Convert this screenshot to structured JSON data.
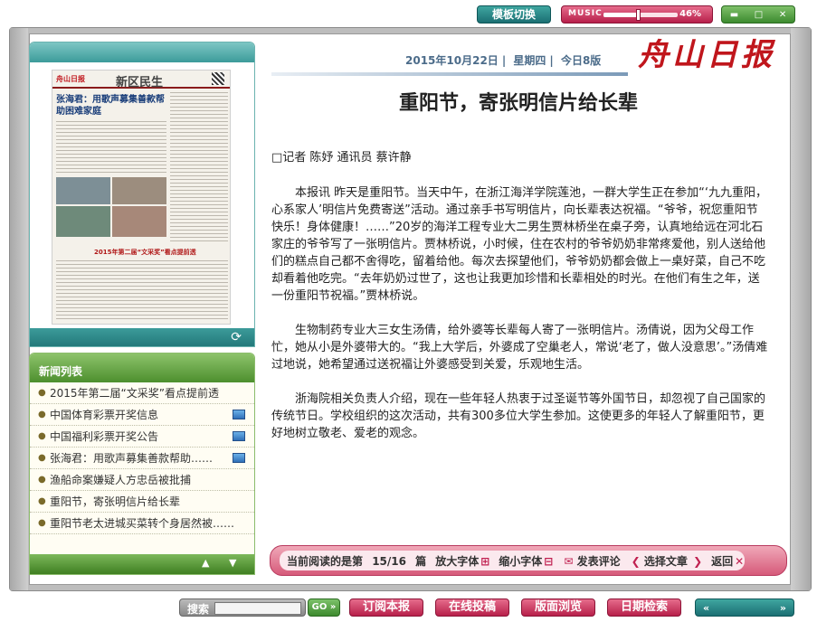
{
  "topbar": {
    "template_switch": "模板切换",
    "music_label": "MUSIC",
    "music_volume_pct": 46,
    "music_volume_text": "46%",
    "min_icon": "minimize-icon",
    "restore_icon": "restore-icon",
    "close_icon": "close-icon"
  },
  "thumbnail": {
    "paper_logo": "舟山日报",
    "section": "新区民生",
    "headline": "张海君：用歌声募集善款帮助困难家庭",
    "banner": "2015年第二届“文采奖”看点提前透",
    "refresh_icon": "refresh-icon"
  },
  "news_list": {
    "title": "新闻列表",
    "items": [
      {
        "label": "2015年第二届“文采奖”看点提前透",
        "has_pic": false
      },
      {
        "label": "中国体育彩票开奖信息",
        "has_pic": true
      },
      {
        "label": "中国福利彩票开奖公告",
        "has_pic": true
      },
      {
        "label": "张海君：用歌声募集善款帮助……",
        "has_pic": true
      },
      {
        "label": "渔船命案嫌疑人方忠岳被批捕",
        "has_pic": false
      },
      {
        "label": "重阳节，寄张明信片给长辈",
        "has_pic": false
      },
      {
        "label": "重阳节老太进城买菜转个身居然被……",
        "has_pic": false
      }
    ],
    "up_icon": "arrow-up-icon",
    "down_icon": "arrow-down-icon"
  },
  "header": {
    "date": "2015年10月22日",
    "weekday": "星期四",
    "editions": "今日8版",
    "masthead": "舟山日报"
  },
  "article": {
    "title": "重阳节，寄张明信片给长辈",
    "byline": "□记者 陈妤 通讯员 蔡许静",
    "paragraphs": [
      "本报讯 昨天是重阳节。当天中午，在浙江海洋学院莲池，一群大学生正在参加“‘九九重阳，心系家人’明信片免费寄送”活动。通过亲手书写明信片，向长辈表达祝福。“爷爷，祝您重阳节快乐！身体健康！……”20岁的海洋工程专业大二男生贾林桥坐在桌子旁，认真地给远在河北石家庄的爷爷写了一张明信片。贾林桥说，小时候，住在农村的爷爷奶奶非常疼爱他，别人送给他们的糕点自己都不舍得吃，留着给他。每次去探望他们，爷爷奶奶都会做上一桌好菜，自己不吃却看着他吃完。“去年奶奶过世了，这也让我更加珍惜和长辈相处的时光。在他们有生之年，送一份重阳节祝福。”贾林桥说。",
      "生物制药专业大三女生汤倩，给外婆等长辈每人寄了一张明信片。汤倩说，因为父母工作忙，她从小是外婆带大的。“我上大学后，外婆成了空巢老人，常说‘老了，做人没意思’。”汤倩难过地说，她希望通过送祝福让外婆感受到关爱，乐观地生活。",
      "浙海院相关负责人介绍，现在一些年轻人热衷于过圣诞节等外国节日，却忽视了自己国家的传统节日。学校组织的这次活动，共有300多位大学生参加。这使更多的年轻人了解重阳节，更好地树立敬老、爱老的观念。"
    ]
  },
  "reader_bar": {
    "current_label": "当前阅读的是第",
    "current_pos": "15/16",
    "unit": "篇",
    "enlarge": "放大字体",
    "shrink": "缩小字体",
    "comment": "发表评论",
    "choose": "选择文章",
    "back": "返回"
  },
  "bottombar": {
    "search_label": "搜索",
    "search_value": "",
    "go_label": "GO",
    "subscribe": "订阅本报",
    "submit": "在线投稿",
    "browse": "版面浏览",
    "date_search": "日期检索"
  }
}
